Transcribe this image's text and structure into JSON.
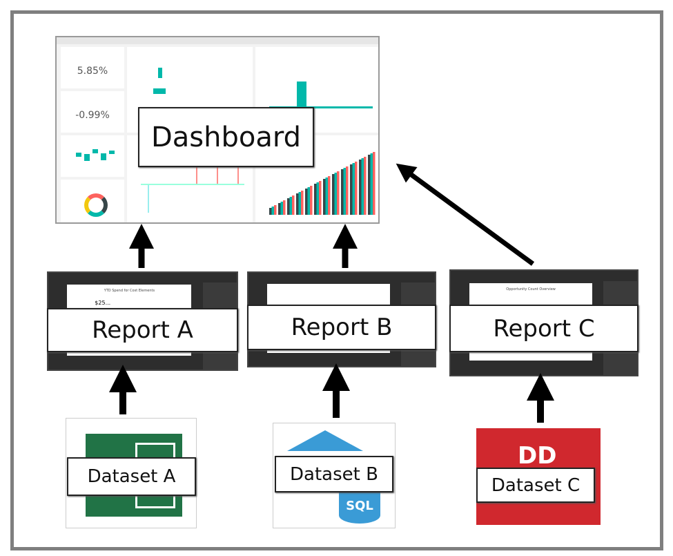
{
  "dashboard": {
    "label": "Dashboard",
    "tiles": {
      "kpi1": "5.85%",
      "kpi2": "-0.99%"
    }
  },
  "reports": [
    {
      "label": "Report A",
      "title": "YTD Spend for Cost Elements",
      "value": "$25..."
    },
    {
      "label": "Report B",
      "title": ""
    },
    {
      "label": "Report C",
      "title": "Opportunity Count Overview"
    }
  ],
  "datasets": [
    {
      "label": "Dataset A",
      "icon": "excel-icon",
      "color": "#217346"
    },
    {
      "label": "Dataset B",
      "icon": "sql-database-icon",
      "color": "#3a9bd6"
    },
    {
      "label": "Dataset C",
      "icon": "dataset-c-logo-icon",
      "color": "#d0282e"
    }
  ],
  "colors": {
    "border": "#7f7f7f",
    "arrow": "#000000",
    "teal": "#01b8aa"
  }
}
